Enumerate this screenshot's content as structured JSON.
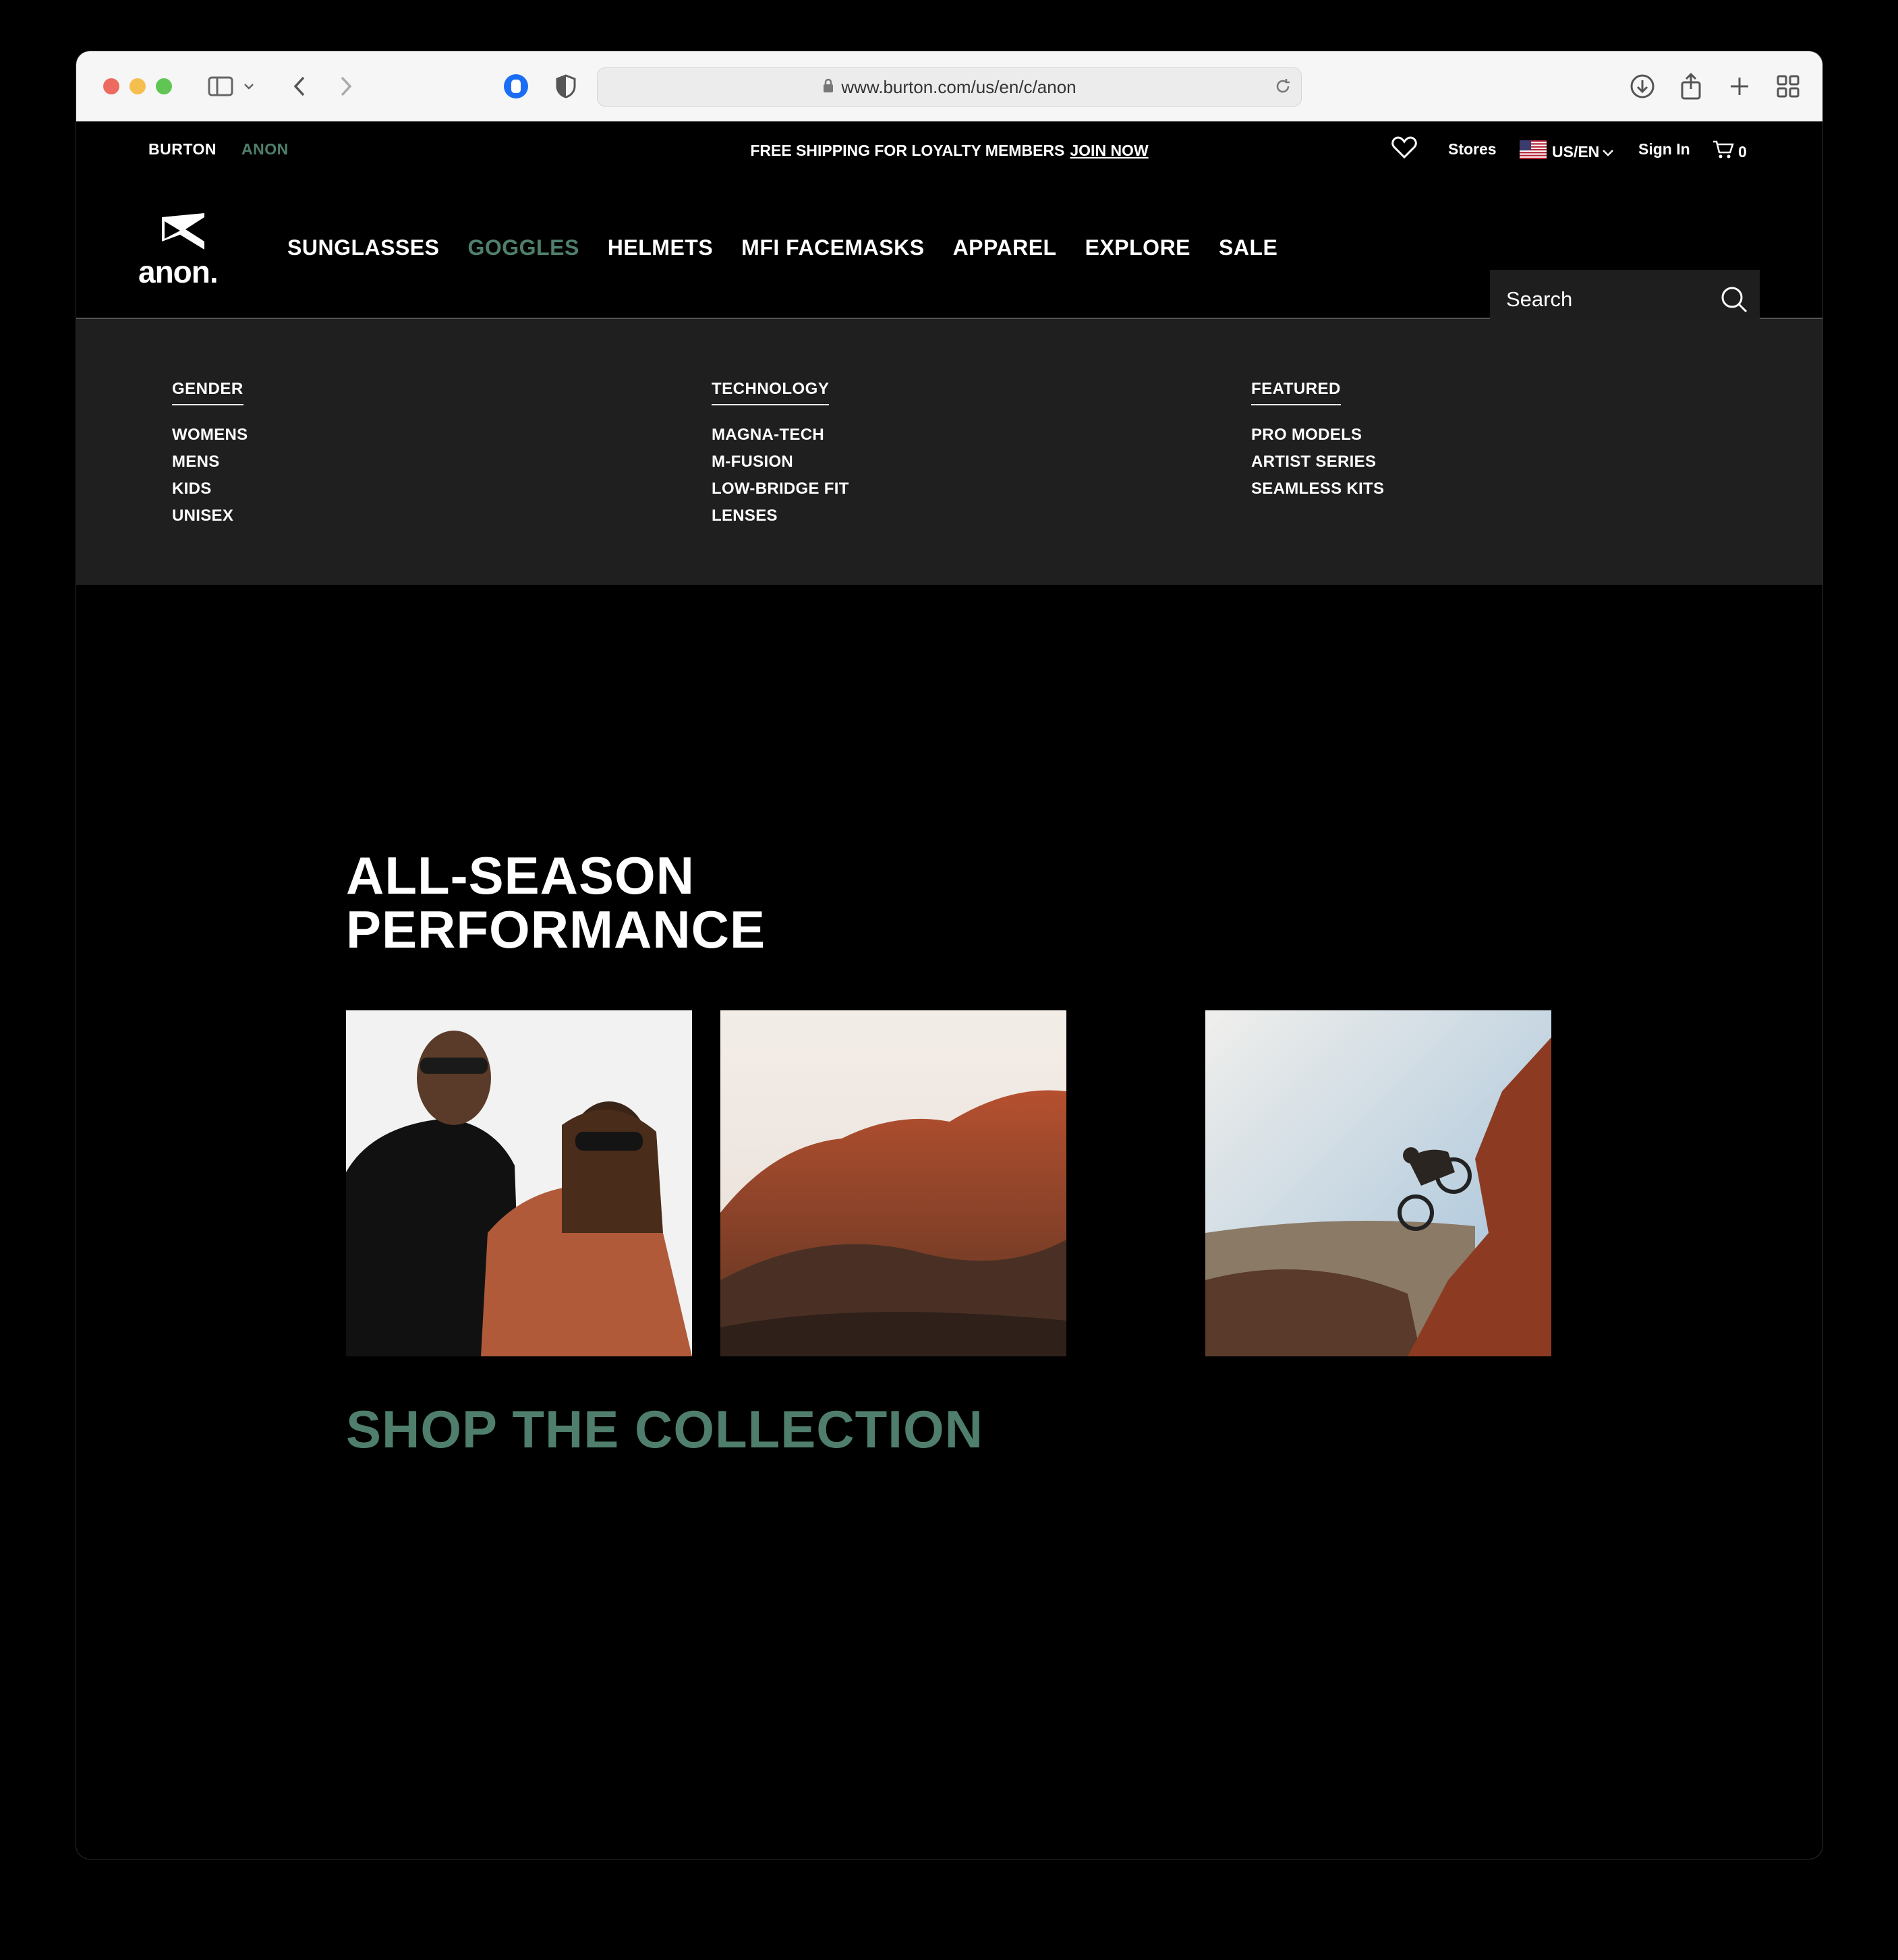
{
  "browser": {
    "url": "www.burton.com/us/en/c/anon"
  },
  "topbar": {
    "brand_burton": "BURTON",
    "brand_anon": "ANON",
    "promo_text": "FREE SHIPPING FOR LOYALTY MEMBERS",
    "promo_link": "JOIN NOW",
    "stores": "Stores",
    "locale": "US/EN",
    "sign_in": "Sign In",
    "cart_count": "0"
  },
  "logo_text": "anon.",
  "nav": {
    "items": [
      "SUNGLASSES",
      "GOGGLES",
      "HELMETS",
      "MFI FACEMASKS",
      "APPAREL",
      "EXPLORE",
      "SALE"
    ],
    "active": "GOGGLES"
  },
  "search": {
    "placeholder": "Search"
  },
  "mega_menu": {
    "columns": [
      {
        "heading": "GENDER",
        "items": [
          "WOMENS",
          "MENS",
          "KIDS",
          "UNISEX"
        ]
      },
      {
        "heading": "TECHNOLOGY",
        "items": [
          "MAGNA-TECH",
          "M-FUSION",
          "LOW-BRIDGE FIT",
          "LENSES"
        ]
      },
      {
        "heading": "FEATURED",
        "items": [
          "PRO MODELS",
          "ARTIST SERIES",
          "SEAMLESS KITS"
        ]
      }
    ]
  },
  "hero": {
    "title_line1": "ALL-SEASON",
    "title_line2": "PERFORMANCE",
    "cta": "SHOP THE COLLECTION"
  },
  "colors": {
    "accent_green": "#4f7f6c",
    "page_bg": "#000000",
    "menu_bg": "#1f1f1f"
  }
}
